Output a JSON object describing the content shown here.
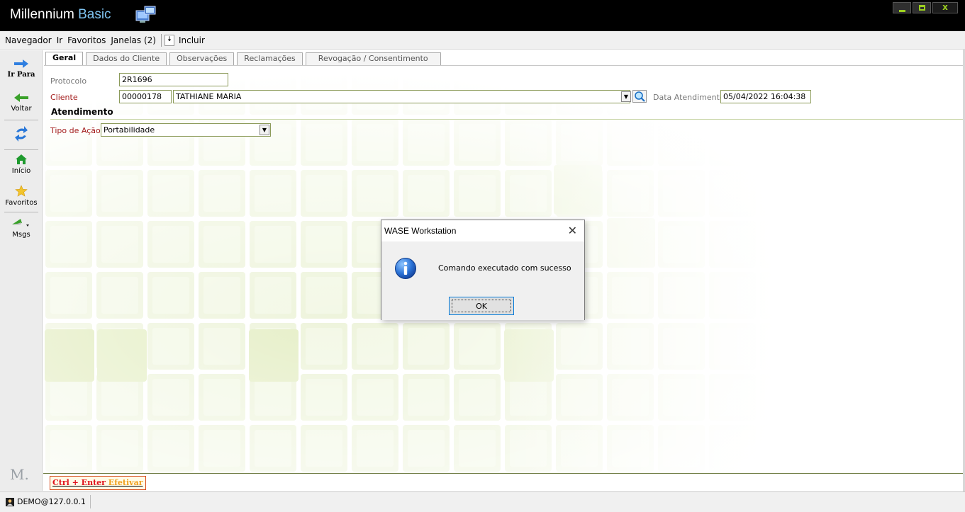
{
  "app": {
    "title_main": "Millennium ",
    "title_accent": "Basic"
  },
  "menu": {
    "items": [
      "Navegador",
      "Ir",
      "Favoritos",
      "Janelas (2)"
    ],
    "include_label": "Incluir"
  },
  "sidebar": {
    "items": [
      {
        "label": "Ir Para",
        "icon": "arrow-right-icon"
      },
      {
        "label": "Voltar",
        "icon": "arrow-left-icon"
      },
      {
        "label": "",
        "icon": "refresh-icon"
      },
      {
        "label": "Início",
        "icon": "home-icon"
      },
      {
        "label": "Favoritos",
        "icon": "star-icon"
      },
      {
        "label": "Msgs",
        "icon": "message-icon"
      }
    ],
    "logo_text": "M."
  },
  "tabs": [
    "Geral",
    "Dados do Cliente",
    "Observações",
    "Reclamações",
    "Revogação / Consentimento"
  ],
  "form": {
    "protocolo_label": "Protocolo",
    "protocolo_value": "2R1696",
    "cliente_label": "Cliente",
    "cliente_code": "00000178",
    "cliente_name": "TATHIANE MARIA",
    "data_label": "Data Atendimento",
    "data_value": "05/04/2022 16:04:38",
    "section_title": "Atendimento",
    "tipo_label": "Tipo de Ação",
    "tipo_value": "Portabilidade"
  },
  "efetivar": {
    "shortcut": "Ctrl + Enter",
    "action": "Efetivar"
  },
  "status": {
    "connection": "DEMO@127.0.0.1"
  },
  "dialog": {
    "title": "WASE Workstation",
    "message": "Comando executado com sucesso",
    "ok_label": "OK"
  },
  "colors": {
    "title_bar": "#000000",
    "title_accent": "#7ec3f0",
    "window_controls": "#9ccf1f",
    "field_border": "#8c9b5a",
    "required_label": "#a31c1c",
    "background_tiles": "#e4efc4"
  }
}
